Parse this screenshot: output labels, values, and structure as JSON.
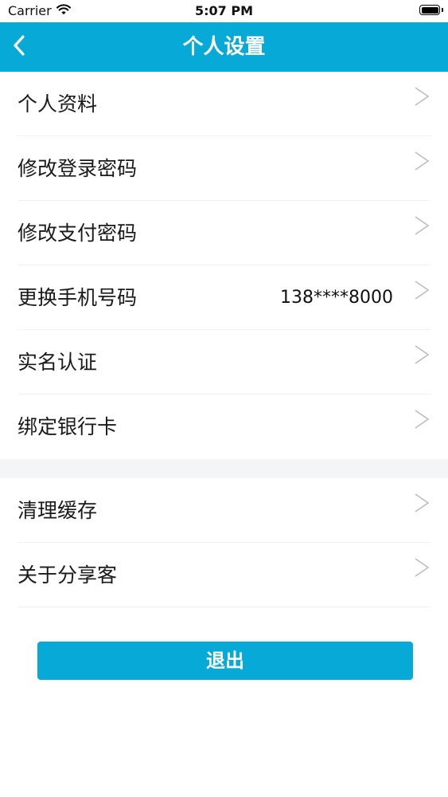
{
  "status_bar": {
    "carrier": "Carrier",
    "time": "5:07 PM",
    "icons": [
      "wifi-icon",
      "battery-icon"
    ]
  },
  "nav_bar": {
    "title": "个人设置",
    "back_icon": "chevron-left-icon",
    "background_color": "#07a9d6"
  },
  "sections": [
    {
      "items": [
        {
          "label": "个人资料"
        },
        {
          "label": "修改登录密码"
        },
        {
          "label": "修改支付密码"
        },
        {
          "label": "更换手机号码",
          "value": "138****8000"
        },
        {
          "label": "实名认证"
        },
        {
          "label": "绑定银行卡"
        }
      ]
    },
    {
      "items": [
        {
          "label": "清理缓存"
        },
        {
          "label": "关于分享客"
        }
      ]
    }
  ],
  "logout": {
    "label": "退出",
    "color": "#07a9d6"
  }
}
